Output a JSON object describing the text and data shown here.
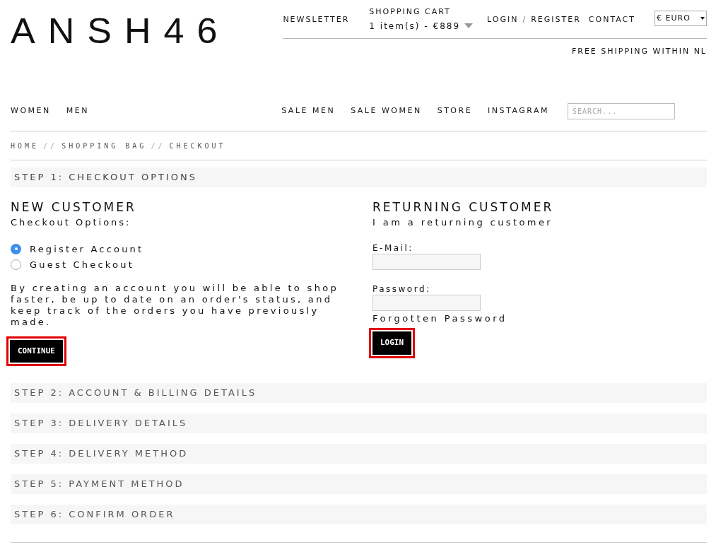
{
  "header": {
    "logo": "ANSH46",
    "links": [
      {
        "label": "NEWSLETTER"
      },
      {
        "label": "LOGIN"
      },
      {
        "label": "/"
      },
      {
        "label": "REGISTER"
      },
      {
        "label": "CONTACT"
      }
    ],
    "cart": {
      "title": "SHOPPING CART",
      "summary": "1 item(s) - €889"
    },
    "currency": "€ EURO",
    "notice": "FREE SHIPPING WITHIN NL"
  },
  "nav": {
    "left": [
      "WOMEN",
      "MEN"
    ],
    "right": [
      "SALE MEN",
      "SALE WOMEN",
      "STORE",
      "INSTAGRAM"
    ],
    "search": {
      "placeholder": "SEARCH..."
    }
  },
  "breadcrumb": [
    "HOME",
    "SHOPPING BAG",
    "CHECKOUT"
  ],
  "breadcrumb_separator": "//",
  "steps": [
    {
      "title": "STEP 1: CHECKOUT OPTIONS",
      "expanded": true
    },
    {
      "title": "STEP 2: ACCOUNT & BILLING DETAILS",
      "expanded": false
    },
    {
      "title": "STEP 3: DELIVERY DETAILS",
      "expanded": false
    },
    {
      "title": "STEP 4: DELIVERY METHOD",
      "expanded": false
    },
    {
      "title": "STEP 5: PAYMENT METHOD",
      "expanded": false
    },
    {
      "title": "STEP 6: CONFIRM ORDER",
      "expanded": false
    }
  ],
  "new_customer": {
    "heading": "NEW CUSTOMER",
    "subheading": "Checkout Options:",
    "options": [
      {
        "label": "Register Account",
        "selected": true
      },
      {
        "label": "Guest Checkout",
        "selected": false
      }
    ],
    "text": "By creating an account you will be able to shop faster, be up to date on an order's status, and keep track of the orders you have previously made.",
    "button": {
      "label": "CONTINUE",
      "highlighted": true
    }
  },
  "returning_customer": {
    "heading": "RETURNING CUSTOMER",
    "subheading": "I am a returning customer",
    "fields": [
      {
        "label": "E-Mail:"
      },
      {
        "label": "Password:"
      }
    ],
    "forgotten": "Forgotten Password",
    "button": {
      "label": "LOGIN",
      "highlighted": true
    }
  }
}
